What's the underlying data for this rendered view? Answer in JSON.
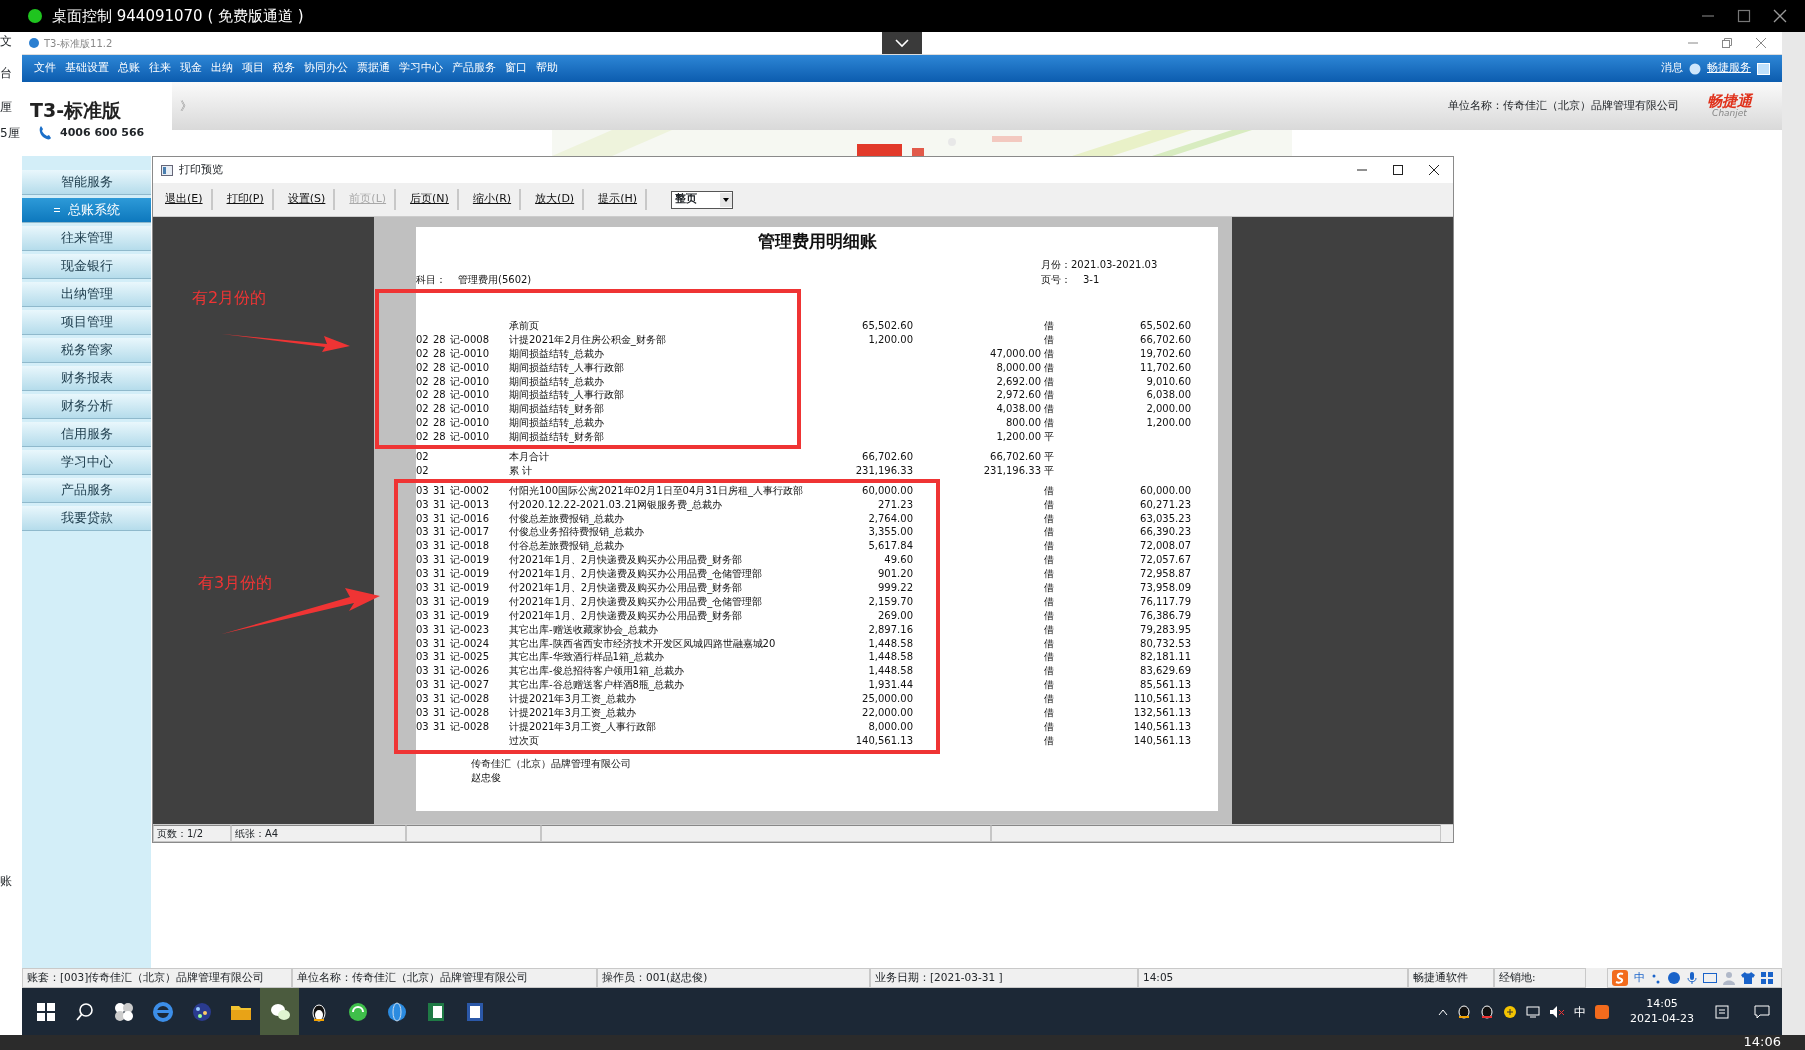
{
  "remote_window": {
    "title": "桌面控制 944091070 ( 免费版通道 )"
  },
  "left_edge_texts": [
    "文",
    "台",
    "厘",
    "5厘",
    "账"
  ],
  "app_window": {
    "title": "T3-标准版11.2"
  },
  "menu": [
    "文件",
    "基础设置",
    "总账",
    "往来",
    "现金",
    "出纳",
    "项目",
    "税务",
    "协同办公",
    "票据通",
    "学习中心",
    "产品服务",
    "窗口",
    "帮助"
  ],
  "menu_right": [
    "消息",
    "畅捷服务"
  ],
  "header": {
    "logo": "T3-标准版",
    "phone": "4006 600 566",
    "company": "单位名称：传奇佳汇（北京）品牌管理有限公司",
    "brand": "畅捷通",
    "brand_en": "Chanjet",
    "toggle": "》"
  },
  "sidebar": {
    "items": [
      {
        "label": "智能服务",
        "selected": false
      },
      {
        "label": "总账系统",
        "selected": true
      },
      {
        "label": "往来管理",
        "selected": false
      },
      {
        "label": "现金银行",
        "selected": false
      },
      {
        "label": "出纳管理",
        "selected": false
      },
      {
        "label": "项目管理",
        "selected": false
      },
      {
        "label": "税务管家",
        "selected": false
      },
      {
        "label": "财务报表",
        "selected": false
      },
      {
        "label": "财务分析",
        "selected": false
      },
      {
        "label": "信用服务",
        "selected": false
      },
      {
        "label": "学习中心",
        "selected": false
      },
      {
        "label": "产品服务",
        "selected": false
      },
      {
        "label": "我要贷款",
        "selected": false
      }
    ]
  },
  "dialog": {
    "title": "打印预览",
    "toolbar": [
      {
        "label": "退出(E)",
        "disabled": false
      },
      {
        "label": "打印(P)",
        "disabled": false
      },
      {
        "label": "设置(S)",
        "disabled": false
      },
      {
        "label": "前页(L)",
        "disabled": true
      },
      {
        "label": "后页(N)",
        "disabled": false
      },
      {
        "label": "缩小(R)",
        "disabled": false
      },
      {
        "label": "放大(D)",
        "disabled": false
      },
      {
        "label": "提示(H)",
        "disabled": false
      }
    ],
    "zoom_select": "整页",
    "status": [
      "页数：1/2",
      "纸张：A4"
    ]
  },
  "document": {
    "title": "管理费用明细账",
    "month_range": "月份：2021.03-2021.03",
    "page_label": "页号：",
    "page_number": "3-1",
    "subject_label": "科目：",
    "subject": "管理费用(5602)",
    "rows": [
      {
        "summary": "承前页",
        "debit": "65,502.60",
        "direction": "借",
        "balance": "65,502.60"
      },
      {
        "month": "02",
        "day": "28",
        "voucher": "记-0008",
        "summary": "计提2021年2月住房公积金_财务部",
        "debit": "1,200.00",
        "direction": "借",
        "balance": "66,702.60"
      },
      {
        "month": "02",
        "day": "28",
        "voucher": "记-0010",
        "summary": "期间损益结转_总裁办",
        "credit": "47,000.00",
        "direction": "借",
        "balance": "19,702.60"
      },
      {
        "month": "02",
        "day": "28",
        "voucher": "记-0010",
        "summary": "期间损益结转_人事行政部",
        "credit": "8,000.00",
        "direction": "借",
        "balance": "11,702.60"
      },
      {
        "month": "02",
        "day": "28",
        "voucher": "记-0010",
        "summary": "期间损益结转_总裁办",
        "credit": "2,692.00",
        "direction": "借",
        "balance": "9,010.60"
      },
      {
        "month": "02",
        "day": "28",
        "voucher": "记-0010",
        "summary": "期间损益结转_人事行政部",
        "credit": "2,972.60",
        "direction": "借",
        "balance": "6,038.00"
      },
      {
        "month": "02",
        "day": "28",
        "voucher": "记-0010",
        "summary": "期间损益结转_财务部",
        "credit": "4,038.00",
        "direction": "借",
        "balance": "2,000.00"
      },
      {
        "month": "02",
        "day": "28",
        "voucher": "记-0010",
        "summary": "期间损益结转_总裁办",
        "credit": "800.00",
        "direction": "借",
        "balance": "1,200.00"
      },
      {
        "month": "02",
        "day": "28",
        "voucher": "记-0010",
        "summary": "期间损益结转_财务部",
        "credit": "1,200.00",
        "direction": "平"
      },
      {
        "month": "02",
        "summary": "本月合计",
        "debit": "66,702.60",
        "credit": "66,702.60",
        "direction": "平"
      },
      {
        "month": "02",
        "summary": "累 计",
        "debit": "231,196.33",
        "credit": "231,196.33",
        "direction": "平"
      },
      {
        "month": "03",
        "day": "31",
        "voucher": "记-0002",
        "summary": "付阳光100国际公寓2021年02月1日至04月31日房租_人事行政部",
        "debit": "60,000.00",
        "direction": "借",
        "balance": "60,000.00"
      },
      {
        "month": "03",
        "day": "31",
        "voucher": "记-0013",
        "summary": "付2020.12.22-2021.03.21网银服务费_总裁办",
        "debit": "271.23",
        "direction": "借",
        "balance": "60,271.23"
      },
      {
        "month": "03",
        "day": "31",
        "voucher": "记-0016",
        "summary": "付俊总差旅费报销_总裁办",
        "debit": "2,764.00",
        "direction": "借",
        "balance": "63,035.23"
      },
      {
        "month": "03",
        "day": "31",
        "voucher": "记-0017",
        "summary": "付俊总业务招待费报销_总裁办",
        "debit": "3,355.00",
        "direction": "借",
        "balance": "66,390.23"
      },
      {
        "month": "03",
        "day": "31",
        "voucher": "记-0018",
        "summary": "付谷总差旅费报销_总裁办",
        "debit": "5,617.84",
        "direction": "借",
        "balance": "72,008.07"
      },
      {
        "month": "03",
        "day": "31",
        "voucher": "记-0019",
        "summary": "付2021年1月、2月快递费及购买办公用品费_财务部",
        "debit": "49.60",
        "direction": "借",
        "balance": "72,057.67"
      },
      {
        "month": "03",
        "day": "31",
        "voucher": "记-0019",
        "summary": "付2021年1月、2月快递费及购买办公用品费_仓储管理部",
        "debit": "901.20",
        "direction": "借",
        "balance": "72,958.87"
      },
      {
        "month": "03",
        "day": "31",
        "voucher": "记-0019",
        "summary": "付2021年1月、2月快递费及购买办公用品费_财务部",
        "debit": "999.22",
        "direction": "借",
        "balance": "73,958.09"
      },
      {
        "month": "03",
        "day": "31",
        "voucher": "记-0019",
        "summary": "付2021年1月、2月快递费及购买办公用品费_仓储管理部",
        "debit": "2,159.70",
        "direction": "借",
        "balance": "76,117.79"
      },
      {
        "month": "03",
        "day": "31",
        "voucher": "记-0019",
        "summary": "付2021年1月、2月快递费及购买办公用品费_财务部",
        "debit": "269.00",
        "direction": "借",
        "balance": "76,386.79"
      },
      {
        "month": "03",
        "day": "31",
        "voucher": "记-0023",
        "summary": "其它出库-赠送收藏家协会_总裁办",
        "debit": "2,897.16",
        "direction": "借",
        "balance": "79,283.95"
      },
      {
        "month": "03",
        "day": "31",
        "voucher": "记-0024",
        "summary": "其它出库-陕西省西安市经济技术开发区凤城四路世融嘉城20",
        "debit": "1,448.58",
        "direction": "借",
        "balance": "80,732.53"
      },
      {
        "month": "03",
        "day": "31",
        "voucher": "记-0025",
        "summary": "其它出库-华致酒行样品1箱_总裁办",
        "debit": "1,448.58",
        "direction": "借",
        "balance": "82,181.11"
      },
      {
        "month": "03",
        "day": "31",
        "voucher": "记-0026",
        "summary": "其它出库-俊总招待客户领用1箱_总裁办",
        "debit": "1,448.58",
        "direction": "借",
        "balance": "83,629.69"
      },
      {
        "month": "03",
        "day": "31",
        "voucher": "记-0027",
        "summary": "其它出库-谷总赠送客户样酒8瓶_总裁办",
        "debit": "1,931.44",
        "direction": "借",
        "balance": "85,561.13"
      },
      {
        "month": "03",
        "day": "31",
        "voucher": "记-0028",
        "summary": "计提2021年3月工资_总裁办",
        "debit": "25,000.00",
        "direction": "借",
        "balance": "110,561.13"
      },
      {
        "month": "03",
        "day": "31",
        "voucher": "记-0028",
        "summary": "计提2021年3月工资_总裁办",
        "debit": "22,000.00",
        "direction": "借",
        "balance": "132,561.13"
      },
      {
        "month": "03",
        "day": "31",
        "voucher": "记-0028",
        "summary": "计提2021年3月工资_人事行政部",
        "debit": "8,000.00",
        "direction": "借",
        "balance": "140,561.13"
      },
      {
        "summary": "过次页",
        "debit": "140,561.13",
        "direction": "借",
        "balance": "140,561.13"
      }
    ],
    "footer": [
      "传奇佳汇（北京）品牌管理有限公司",
      "赵忠俊"
    ]
  },
  "annotations": [
    {
      "text": "有2月份的"
    },
    {
      "text": "有3月份的"
    }
  ],
  "status_bar": [
    "账套：[003]传奇佳汇（北京）品牌管理有限公司",
    "单位名称：传奇佳汇（北京）品牌管理有限公司",
    "操作员：001(赵忠俊)",
    "业务日期：[2021-03-31 ]",
    "14:05",
    "畅捷通软件",
    "经销地:"
  ],
  "ime": {
    "mode": "中"
  },
  "taskbar": {
    "input_mode": "中",
    "time": "14:05",
    "date": "2021-04-23"
  },
  "host_taskbar": {
    "time": "14:06"
  }
}
